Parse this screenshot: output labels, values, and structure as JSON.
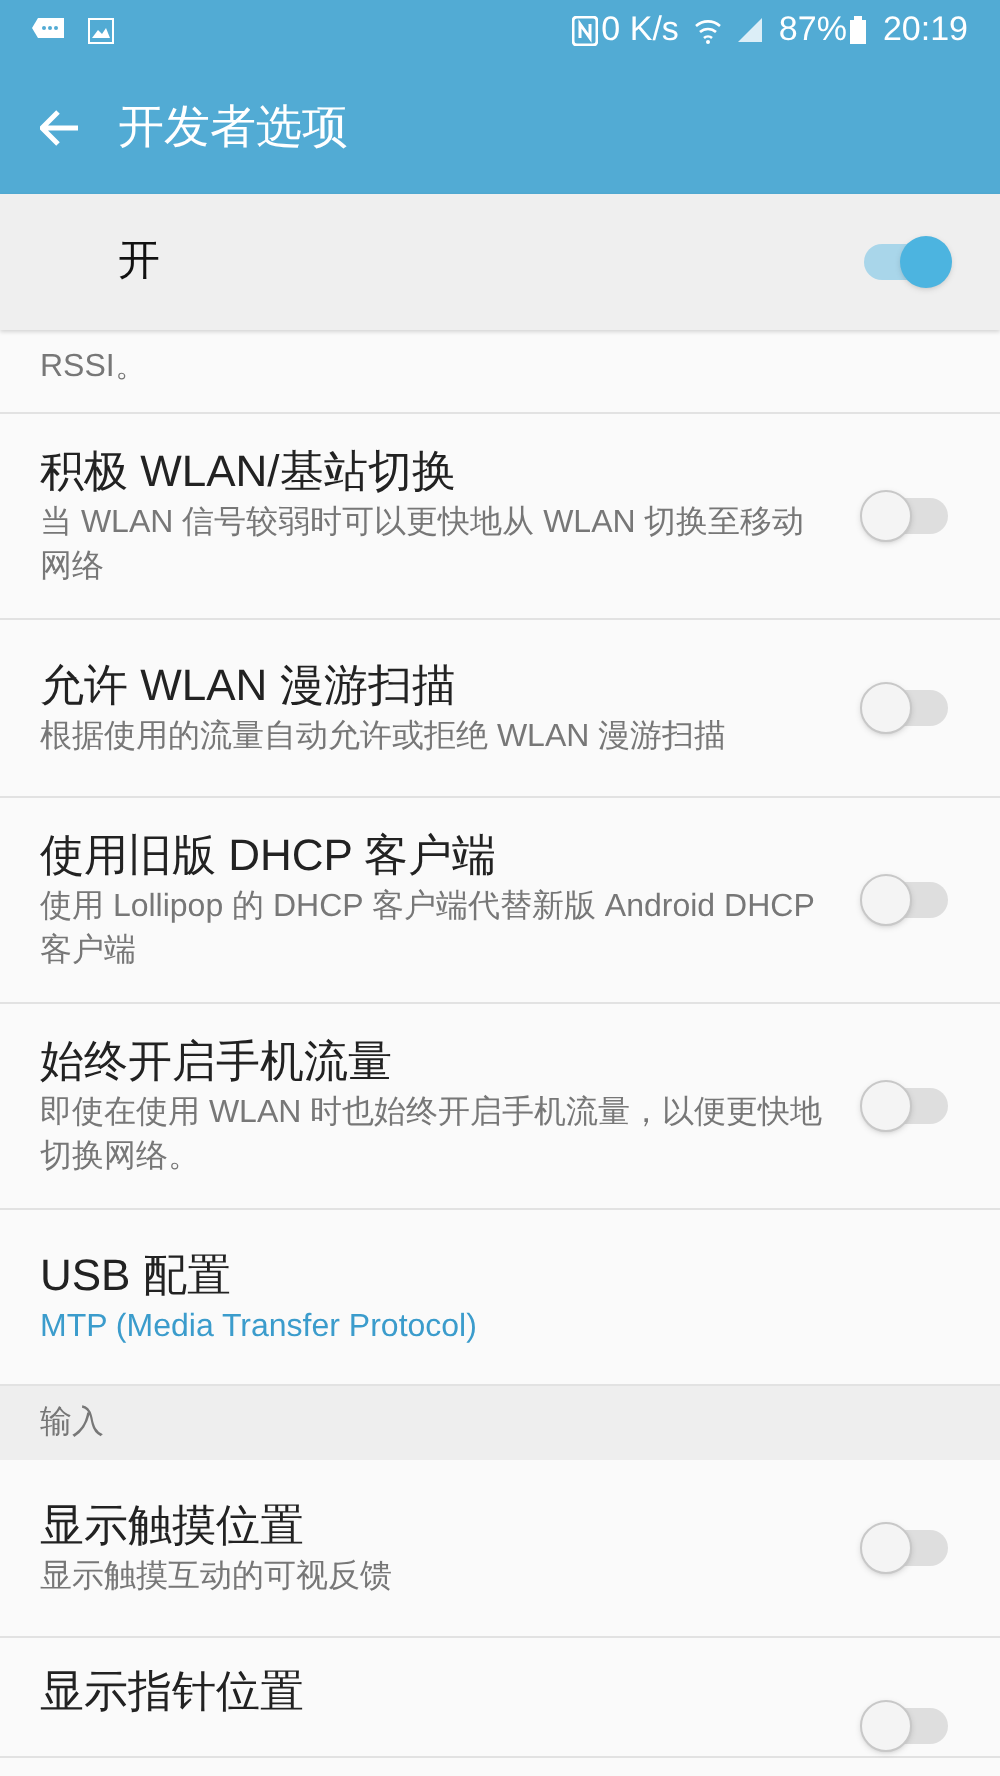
{
  "status_bar": {
    "speed": "0 K/s",
    "battery": "87%",
    "time": "20:19"
  },
  "app_bar": {
    "title": "开发者选项"
  },
  "master_switch": {
    "label": "开",
    "on": true
  },
  "items": [
    {
      "kind": "tail",
      "summary": "RSSI。"
    },
    {
      "kind": "toggle",
      "title": "积极 WLAN/基站切换",
      "summary": "当 WLAN 信号较弱时可以更快地从 WLAN 切换至移动网络",
      "on": false
    },
    {
      "kind": "toggle",
      "title": "允许 WLAN 漫游扫描",
      "summary": "根据使用的流量自动允许或拒绝 WLAN 漫游扫描",
      "on": false
    },
    {
      "kind": "toggle",
      "title": "使用旧版 DHCP 客户端",
      "summary": "使用 Lollipop 的 DHCP 客户端代替新版 Android DHCP 客户端",
      "on": false
    },
    {
      "kind": "toggle",
      "title": "始终开启手机流量",
      "summary": "即使在使用 WLAN 时也始终开启手机流量，以便更快地切换网络。",
      "on": false
    },
    {
      "kind": "value",
      "title": "USB 配置",
      "summary": "MTP (Media Transfer Protocol)"
    },
    {
      "kind": "header",
      "title": "输入"
    },
    {
      "kind": "toggle",
      "title": "显示触摸位置",
      "summary": "显示触摸互动的可视反馈",
      "on": false
    },
    {
      "kind": "toggle",
      "title": "显示指针位置",
      "on": false
    }
  ]
}
